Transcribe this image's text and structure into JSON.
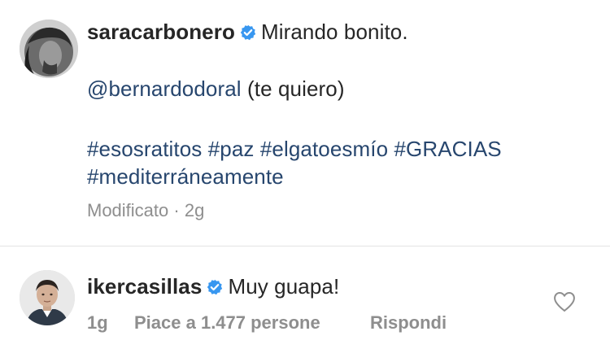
{
  "post": {
    "username": "saracarbonero",
    "caption": "Mirando bonito.",
    "mention": "@bernardodoral",
    "mention_suffix": "(te quiero)",
    "hashtags_line1": [
      "#esosratitos",
      "#paz",
      "#elgatoesmío",
      "#GRACIAS"
    ],
    "hashtags_line2": [
      "#mediterráneamente"
    ],
    "edited_label": "Modificato",
    "separator": "·",
    "time": "2g",
    "verified_icon": "verified-badge-icon"
  },
  "comment": {
    "username": "ikercasillas",
    "text": "Muy guapa!",
    "time": "1g",
    "likes_label": "Piace a 1.477 persone",
    "reply_label": "Rispondi",
    "verified_icon": "verified-badge-icon",
    "like_icon": "heart-outline-icon"
  },
  "colors": {
    "link": "#27466e",
    "text": "#262626",
    "meta": "#8e8e8e",
    "verified": "#3897f0",
    "divider": "#e3e3e3"
  }
}
